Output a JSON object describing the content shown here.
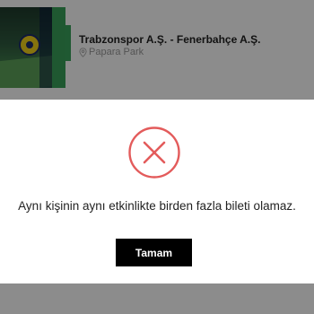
{
  "event": {
    "title": "Trabzonspor A.Ş. - Fenerbahçe A.Ş.",
    "venue": "Papara Park",
    "venue_icon": "location-pin-icon"
  },
  "dialog": {
    "icon": "error-x-circle-icon",
    "icon_color": "#e35b5b",
    "message": "Aynı kişinin aynı etkinlikte birden fazla bileti olamaz.",
    "ok_label": "Tamam"
  },
  "colors": {
    "overlay": "rgba(0,0,0,0.45)",
    "button_bg": "#000000",
    "button_text": "#ffffff",
    "accent_green": "#39a35b"
  }
}
